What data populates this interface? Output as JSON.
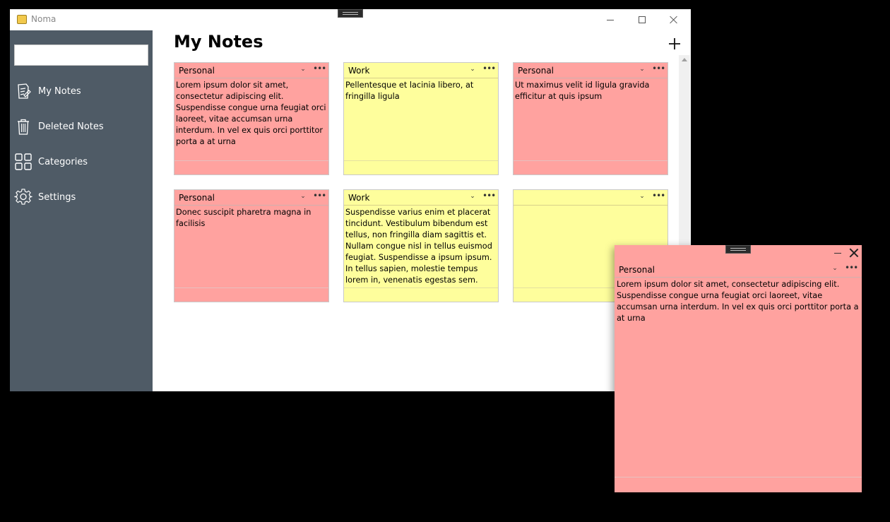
{
  "app": {
    "title": "Noma",
    "accent": "#4f5b66"
  },
  "sidebar": {
    "search": {
      "value": "",
      "placeholder": ""
    },
    "items": [
      {
        "label": "My Notes",
        "icon": "notes-icon"
      },
      {
        "label": "Deleted Notes",
        "icon": "trash-icon"
      },
      {
        "label": "Categories",
        "icon": "grid-icon"
      },
      {
        "label": "Settings",
        "icon": "gear-icon"
      }
    ]
  },
  "main": {
    "title": "My Notes",
    "add_label": "+"
  },
  "colors": {
    "personal": "#ffa29f",
    "work": "#fefe9c"
  },
  "notes": [
    {
      "category": "Personal",
      "color": "pink",
      "text": "Lorem ipsum dolor sit amet, consectetur adipiscing elit. Suspendisse congue urna feugiat orci laoreet, vitae accumsan urna interdum. In vel ex quis orci porttitor porta a at urna"
    },
    {
      "category": "Work",
      "color": "yellow",
      "text": "Pellentesque et lacinia libero, at fringilla ligula"
    },
    {
      "category": "Personal",
      "color": "pink",
      "text": "Ut maximus velit id ligula gravida efficitur at quis ipsum"
    },
    {
      "category": "Personal",
      "color": "pink",
      "text": "Donec suscipit pharetra magna in facilisis"
    },
    {
      "category": "Work",
      "color": "yellow",
      "text": "Suspendisse varius enim et placerat tincidunt. Vestibulum bibendum est tellus, non fringilla diam sagittis et. Nullam congue nisl in tellus euismod feugiat. Suspendisse a ipsum ipsum. In tellus sapien, molestie tempus lorem in, venenatis egestas sem. Fusce libero nisl,"
    },
    {
      "category": "",
      "color": "yellow",
      "text": ""
    }
  ],
  "floating_note": {
    "category": "Personal",
    "text": "Lorem ipsum dolor sit amet, consectetur adipiscing elit. Suspendisse congue urna feugiat orci laoreet, vitae accumsan urna interdum. In vel ex quis orci porttitor porta a at urna"
  }
}
